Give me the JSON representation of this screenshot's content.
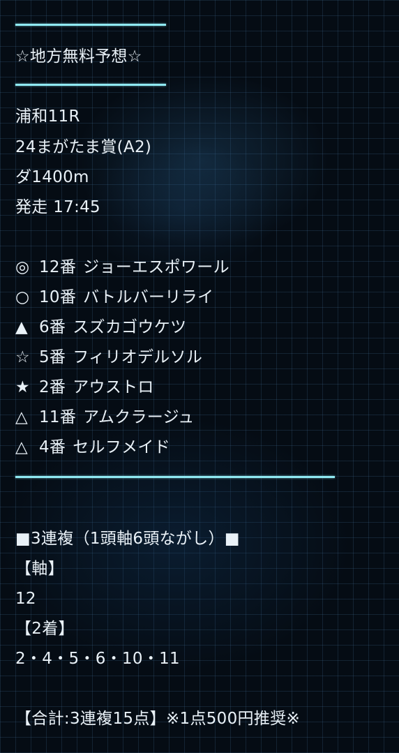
{
  "header": {
    "title": "☆地方無料予想☆"
  },
  "race": {
    "venue_race": "浦和11R",
    "name": "24まがたま賞(A2)",
    "distance": "ダ1400m",
    "start": "発走 17:45"
  },
  "picks": [
    {
      "mark": "◎",
      "number": "12番",
      "horse": "ジョーエスポワール"
    },
    {
      "mark": "○",
      "number": "10番",
      "horse": "バトルバーリライ"
    },
    {
      "mark": "▲",
      "number": "6番",
      "horse": "スズカゴウケツ"
    },
    {
      "mark": "☆",
      "number": "5番",
      "horse": "フィリオデルソル"
    },
    {
      "mark": "★",
      "number": "2番",
      "horse": "アウストロ"
    },
    {
      "mark": "△",
      "number": "11番",
      "horse": "アムクラージュ"
    },
    {
      "mark": "△",
      "number": "4番",
      "horse": "セルフメイド"
    }
  ],
  "bet": {
    "type_label": "■3連複（1頭軸6頭ながし）■",
    "axis_label": "【軸】",
    "axis_value": "12",
    "second_label": "【2着】",
    "second_value": "2・4・5・6・10・11",
    "summary": "【合計:3連複15点】※1点500円推奨※"
  },
  "colors": {
    "background": "#050c14",
    "grid": "#46789f",
    "rule": "#8fe9f2",
    "text": "#e9f1f7"
  }
}
